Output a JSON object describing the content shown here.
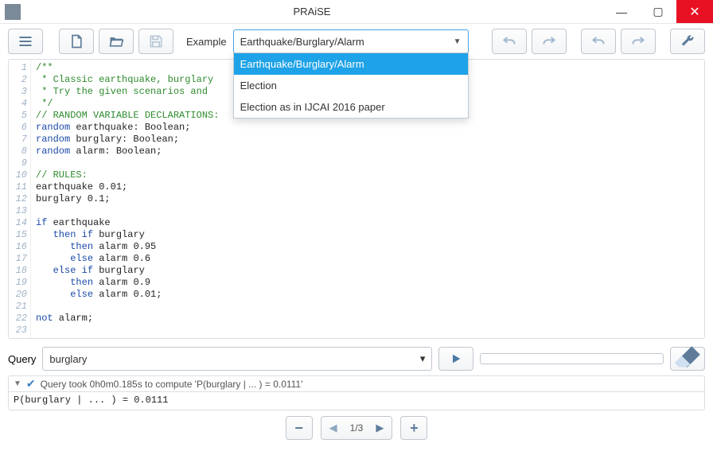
{
  "window": {
    "title": "PRAiSE"
  },
  "toolbar": {
    "example_label": "Example",
    "combo_selected": "Earthquake/Burglary/Alarm",
    "dropdown": {
      "options": [
        {
          "label": "Earthquake/Burglary/Alarm",
          "selected": true
        },
        {
          "label": "Election",
          "selected": false
        },
        {
          "label": "Election as in IJCAI 2016 paper",
          "selected": false
        }
      ]
    }
  },
  "code": {
    "lines": [
      {
        "n": 1,
        "cls": "c-comment",
        "text": "/**"
      },
      {
        "n": 2,
        "cls": "c-comment",
        "text": " * Classic earthquake, burglary                                    fect;"
      },
      {
        "n": 3,
        "cls": "c-comment",
        "text": " * Try the given scenarios and                                     of them."
      },
      {
        "n": 4,
        "cls": "c-comment",
        "text": " */"
      },
      {
        "n": 5,
        "cls": "c-comment",
        "text": "// RANDOM VARIABLE DECLARATIONS:"
      },
      {
        "n": 6,
        "cls": "",
        "kw": "random",
        "rest": " earthquake: Boolean;"
      },
      {
        "n": 7,
        "cls": "",
        "kw": "random",
        "rest": " burglary: Boolean;"
      },
      {
        "n": 8,
        "cls": "",
        "kw": "random",
        "rest": " alarm: Boolean;"
      },
      {
        "n": 9,
        "cls": "",
        "text": ""
      },
      {
        "n": 10,
        "cls": "c-comment",
        "text": "// RULES:"
      },
      {
        "n": 11,
        "cls": "",
        "text": "earthquake 0.01;"
      },
      {
        "n": 12,
        "cls": "",
        "text": "burglary 0.1;"
      },
      {
        "n": 13,
        "cls": "",
        "text": ""
      },
      {
        "n": 14,
        "cls": "",
        "kw": "if",
        "rest": " earthquake"
      },
      {
        "n": 15,
        "cls": "",
        "indent": "   ",
        "kw": "then if",
        "rest": " burglary"
      },
      {
        "n": 16,
        "cls": "",
        "indent": "      ",
        "kw": "then",
        "rest": " alarm 0.95"
      },
      {
        "n": 17,
        "cls": "",
        "indent": "      ",
        "kw": "else",
        "rest": " alarm 0.6"
      },
      {
        "n": 18,
        "cls": "",
        "indent": "   ",
        "kw": "else if",
        "rest": " burglary"
      },
      {
        "n": 19,
        "cls": "",
        "indent": "      ",
        "kw": "then",
        "rest": " alarm 0.9"
      },
      {
        "n": 20,
        "cls": "",
        "indent": "      ",
        "kw": "else",
        "rest": " alarm 0.01;"
      },
      {
        "n": 21,
        "cls": "",
        "text": ""
      },
      {
        "n": 22,
        "cls": "",
        "kw": "not",
        "rest": " alarm;"
      },
      {
        "n": 23,
        "cls": "",
        "text": ""
      }
    ]
  },
  "query": {
    "label": "Query",
    "value": "burglary",
    "status": "Query took 0h0m0.185s to compute 'P(burglary | ... ) = 0.0111'",
    "result": "P(burglary | ... ) = 0.0111"
  },
  "pager": {
    "text": "1/3"
  },
  "icons": {
    "menu": "menu-icon",
    "new": "new-file-icon",
    "open": "open-folder-icon",
    "save": "save-icon",
    "undo": "undo-icon",
    "redo": "redo-icon",
    "undo2": "undo-all-icon",
    "redo2": "redo-all-icon",
    "wrench": "settings-icon",
    "play": "play-icon",
    "eraser": "eraser-icon",
    "minus": "remove-page-icon",
    "prev": "prev-icon",
    "next": "next-icon",
    "plus": "add-page-icon",
    "check": "check-icon",
    "chevdown": "chevron-down-icon"
  }
}
